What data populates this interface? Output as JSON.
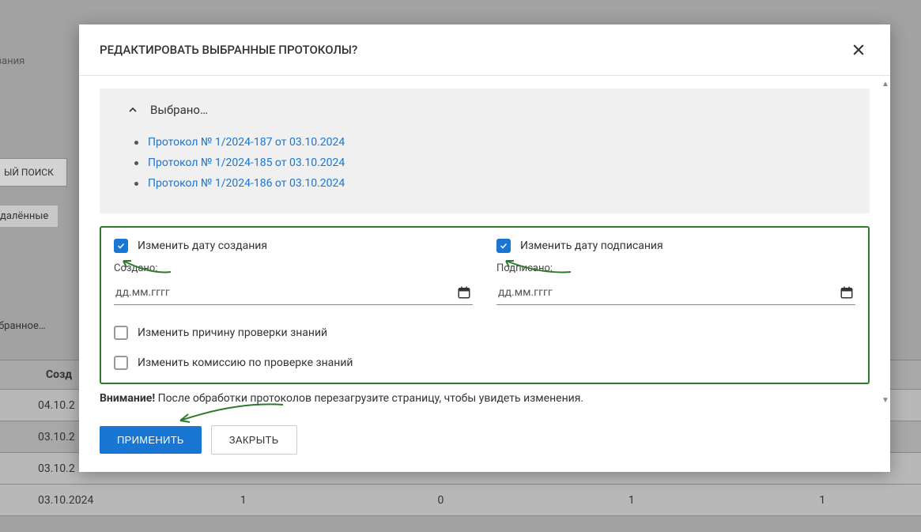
{
  "modal": {
    "title": "РЕДАКТИРОВАТЬ ВЫБРАННЫЕ ПРОТОКОЛЫ?",
    "selected_header": "Выбрано…",
    "protocols": [
      "Протокол № 1/2024-187 от 03.10.2024",
      "Протокол № 1/2024-185 от 03.10.2024",
      "Протокол № 1/2024-186 от 03.10.2024"
    ],
    "creation": {
      "check_label": "Изменить дату создания",
      "field_label": "Создано:",
      "placeholder": "дд.мм.гггг"
    },
    "signing": {
      "check_label": "Изменить дату подписания",
      "field_label": "Подписано:",
      "placeholder": "дд.мм.гггг"
    },
    "reason_check": "Изменить причину проверки знаний",
    "commission_check": "Изменить комиссию по проверке знаний",
    "warning_bold": "Внимание!",
    "warning_text": " После обработки протоколов перезагрузите страницу, чтобы увидеть изменения.",
    "apply": "ПРИМЕНИТЬ",
    "close": "ЗАКРЫТЬ"
  },
  "bg": {
    "header_partial": "звания",
    "search_btn": "ЫЙ ПОИСК",
    "deleted": "далённые",
    "selected_partial": "ыбранное…",
    "col_created": "Созд",
    "rows": [
      {
        "date": "04.10.2"
      },
      {
        "date": "03.10.2"
      },
      {
        "date": "03.10.2"
      },
      {
        "date": "03.10.2024",
        "c1": "1",
        "c2": "0",
        "c3": "1",
        "c4": "1"
      }
    ]
  }
}
